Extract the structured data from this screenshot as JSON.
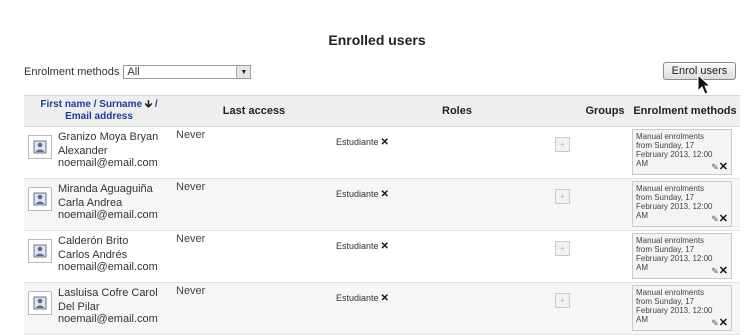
{
  "page_title": "Enrolled users",
  "filter": {
    "label": "Enrolment methods",
    "selected": "All"
  },
  "enrol_button_label": "Enrol users",
  "table": {
    "headers": {
      "name_line1": "First name / Surname",
      "name_line2": "Email address",
      "last_access": "Last access",
      "roles": "Roles",
      "groups": "Groups",
      "enrolment_methods": "Enrolment methods"
    },
    "rows": [
      {
        "name_line1": "Granizo Moya Bryan",
        "name_line2": "Alexander",
        "email": "noemail@email.com",
        "last_access": "Never",
        "role": "Estudiante",
        "enrolment": [
          "Manual enrolments",
          "from Sunday, 17",
          "February 2013, 12:00",
          "AM"
        ]
      },
      {
        "name_line1": "Miranda Aguaguiña",
        "name_line2": "Carla Andrea",
        "email": "noemail@email.com",
        "last_access": "Never",
        "role": "Estudiante",
        "enrolment": [
          "Manual enrolments",
          "from Sunday, 17",
          "February 2013, 12:00",
          "AM"
        ]
      },
      {
        "name_line1": "Calderón Brito",
        "name_line2": "Carlos Andrés",
        "email": "noemail@email.com",
        "last_access": "Never",
        "role": "Estudiante",
        "enrolment": [
          "Manual enrolments",
          "from Sunday, 17",
          "February 2013, 12:00",
          "AM"
        ]
      },
      {
        "name_line1": "Lasluisa Cofre Carol",
        "name_line2": "Del Pilar",
        "email": "noemail@email.com",
        "last_access": "Never",
        "role": "Estudiante",
        "enrolment": [
          "Manual enrolments",
          "from Sunday, 17",
          "February 2013, 12:00",
          "AM"
        ]
      }
    ]
  },
  "icons": {
    "sort": "sort-down-arrow-icon",
    "remove_role": "x-icon",
    "add_role": "plus-icon",
    "edit": "pencil-icon",
    "unenrol": "x-icon",
    "avatar": "user-picture-icon"
  }
}
